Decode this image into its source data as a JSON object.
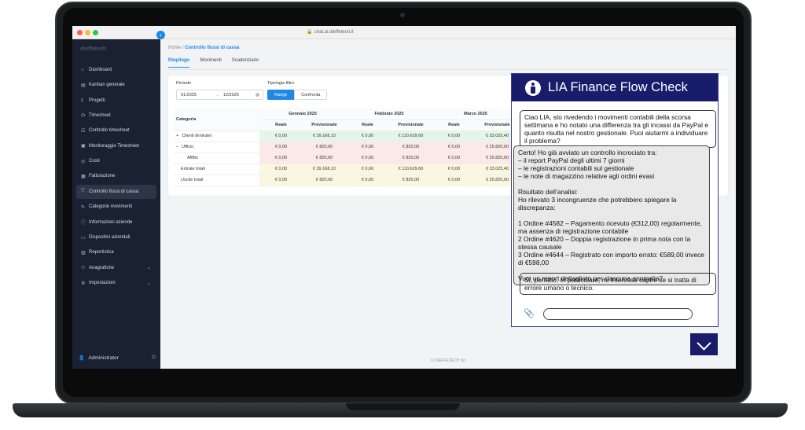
{
  "browser": {
    "url": "chat.ai.dieffetech.it"
  },
  "sidebar": {
    "logo": "dieffetech",
    "items": [
      {
        "label": "Dashboard",
        "icon": "home-icon"
      },
      {
        "label": "Kanban generale",
        "icon": "kanban-icon"
      },
      {
        "label": "Progetti",
        "icon": "bookmark-icon"
      },
      {
        "label": "Timesheet",
        "icon": "clock-icon"
      },
      {
        "label": "Controllo timesheet",
        "icon": "check-icon"
      },
      {
        "label": "Monitoraggio Timesheet",
        "icon": "monitor-icon"
      },
      {
        "label": "Costi",
        "icon": "cost-icon"
      },
      {
        "label": "Fatturazione",
        "icon": "invoice-icon"
      },
      {
        "label": "Controllo flussi di cassa",
        "icon": "shield-icon",
        "active": true
      },
      {
        "label": "Categorie movimenti",
        "icon": "refresh-icon"
      },
      {
        "label": "Informazioni aziende",
        "icon": "info-icon"
      },
      {
        "label": "Dispositivi aziendali",
        "icon": "device-icon"
      },
      {
        "label": "Reportistica",
        "icon": "report-icon"
      },
      {
        "label": "Anagrafiche",
        "icon": "registry-icon",
        "expandable": true
      },
      {
        "label": "Impostazioni",
        "icon": "settings-icon",
        "expandable": true
      }
    ],
    "user": "Administrator"
  },
  "breadcrumb": {
    "home": "Home",
    "separator": "/",
    "current": "Controllo flussi di cassa"
  },
  "tabs": [
    "Riepilogo",
    "Movimenti",
    "Scadenziario"
  ],
  "filters": {
    "period_label": "Periodo",
    "date_from": "01/2025",
    "date_to": "12/2025",
    "type_label": "Tipologia filtro",
    "options": [
      "Range",
      "Confronta"
    ],
    "selected": "Range"
  },
  "table": {
    "category_header": "Categoria",
    "months": [
      "Gennaio 2025",
      "Febbraio 2025",
      "Marzo 2025"
    ],
    "sub_headers": [
      "Reale",
      "Previsionale"
    ],
    "rows": [
      {
        "label": "Clienti (Entrate)",
        "prefix": "+",
        "values": [
          "€ 0,00",
          "€ 39.168,10",
          "€ 0,00",
          "€ 110.629,60",
          "€ 0,00",
          "€ 33.025,40"
        ],
        "tone": "g"
      },
      {
        "label": "Ufficio",
        "prefix": "–",
        "values": [
          "€ 0,00",
          "€ 820,00",
          "€ 0,00",
          "€ 820,00",
          "€ 0,00",
          "€ 25.820,00"
        ],
        "tone": "r"
      },
      {
        "label": "Affitto",
        "prefix": "",
        "values": [
          "€ 0,00",
          "€ 820,00",
          "€ 0,00",
          "€ 820,00",
          "€ 0,00",
          "€ 25.820,00"
        ],
        "tone": "r"
      },
      {
        "label": "Entrate totali",
        "prefix": "",
        "values": [
          "€ 0,00",
          "€ 39.168,10",
          "€ 0,00",
          "€ 110.629,60",
          "€ 0,00",
          "€ 33.025,40"
        ],
        "tone": "y"
      },
      {
        "label": "Uscite totali",
        "prefix": "",
        "values": [
          "€ 0,00",
          "€ 820,00",
          "€ 0,00",
          "€ 820,00",
          "€ 0,00",
          "€ 25.820,00"
        ],
        "tone": "y"
      }
    ]
  },
  "footer": "© DIEFFETECH Srl",
  "chat": {
    "title": "LIA Finance Flow Check",
    "messages": [
      {
        "role": "user",
        "text": "Ciao LIA, sto rivedendo i movimenti contabili della scorsa settimana e ho notato una differenza tra gli incassi da PayPal e quanto risulta nel nostro gestionale. Puoi aiutarmi a individuare il problema?"
      },
      {
        "role": "assistant",
        "text": "Certo! Ho già avviato un controllo incrociato tra:\n– il report PayPal degli ultimi 7 giorni\n– le registrazioni contabili sul gestionale\n– le note di magazzino relative agli ordini evasi\n\nRisultato dell’analisi:\nHo rilevato 3 incongruenze che potrebbero spiegare la discrepanza:\n\n1 Ordine #4582 – Pagamento ricevuto (€312,00) regolarmente, ma assenza di registrazione contabile\n2 Ordine #4620 – Doppia registrazione in prima nota con la stessa causale\n3 Ordine #4644 – Registrato con importo errato: €589,00 invece di €598,00\n\nVuoi un report dettagliato per ciascuna anomalia?"
      },
      {
        "role": "user",
        "text": "Sì, perfetto. In particolare, mi interessa capire se si tratta di errore umano o tecnico."
      }
    ],
    "input_placeholder": ""
  }
}
